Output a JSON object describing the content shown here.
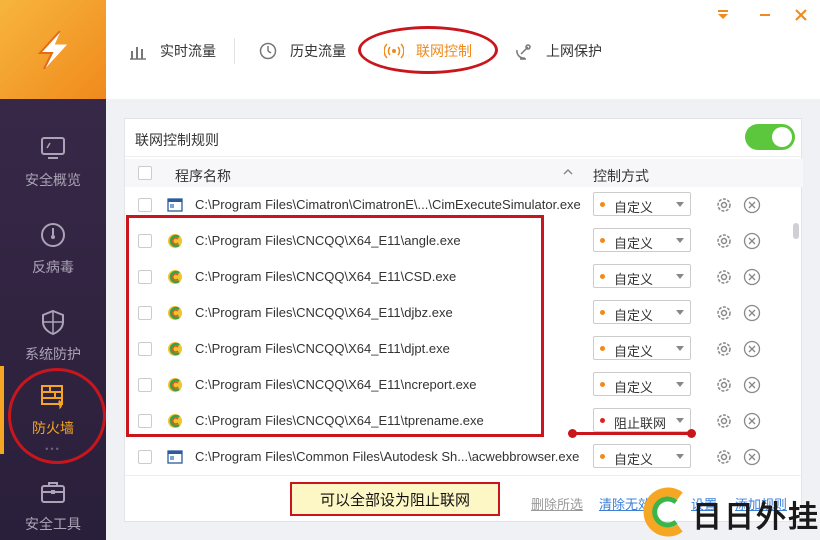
{
  "sidebar": {
    "items": [
      {
        "label": "安全概览",
        "icon": "monitor-icon"
      },
      {
        "label": "反病毒",
        "icon": "gauge-icon"
      },
      {
        "label": "系统防护",
        "icon": "shield-icon"
      },
      {
        "label": "防火墙",
        "icon": "firewall-icon",
        "active": true
      },
      {
        "label": "安全工具",
        "icon": "toolbox-icon"
      }
    ]
  },
  "tabs": [
    {
      "label": "实时流量",
      "icon": "bar-chart-icon"
    },
    {
      "label": "历史流量",
      "icon": "clock-icon"
    },
    {
      "label": "联网控制",
      "icon": "broadcast-icon",
      "active": true
    },
    {
      "label": "上网保护",
      "icon": "satellite-icon"
    }
  ],
  "panel": {
    "title": "联网控制规则",
    "toggle_on": true
  },
  "table": {
    "col_program": "程序名称",
    "col_control": "控制方式",
    "rows": [
      {
        "path": "C:\\Program Files\\Cimatron\\CimatronE\\...\\CimExecuteSimulator.exe",
        "mode": "自定义",
        "mode_color": "orange",
        "icon": "window-app-icon"
      },
      {
        "path": "C:\\Program Files\\CNCQQ\\X64_E11\\angle.exe",
        "mode": "自定义",
        "mode_color": "orange",
        "icon": "cimatron-app-icon"
      },
      {
        "path": "C:\\Program Files\\CNCQQ\\X64_E11\\CSD.exe",
        "mode": "自定义",
        "mode_color": "orange",
        "icon": "cimatron-app-icon"
      },
      {
        "path": "C:\\Program Files\\CNCQQ\\X64_E11\\djbz.exe",
        "mode": "自定义",
        "mode_color": "orange",
        "icon": "cimatron-app-icon"
      },
      {
        "path": "C:\\Program Files\\CNCQQ\\X64_E11\\djpt.exe",
        "mode": "自定义",
        "mode_color": "orange",
        "icon": "cimatron-app-icon"
      },
      {
        "path": "C:\\Program Files\\CNCQQ\\X64_E11\\ncreport.exe",
        "mode": "自定义",
        "mode_color": "orange",
        "icon": "cimatron-app-icon"
      },
      {
        "path": "C:\\Program Files\\CNCQQ\\X64_E11\\tprename.exe",
        "mode": "阻止联网",
        "mode_color": "red",
        "icon": "cimatron-app-icon"
      },
      {
        "path": "C:\\Program Files\\Common Files\\Autodesk Sh...\\acwebbrowser.exe",
        "mode": "自定义",
        "mode_color": "orange",
        "icon": "window-app-icon"
      }
    ]
  },
  "footer": {
    "delete_selected": "删除所选",
    "clear_invalid": "清除无效",
    "settings": "设置",
    "add_rule": "添加规则"
  },
  "annotation": {
    "note": "可以全部设为阻止联网"
  },
  "watermark": {
    "text": "日日外挂"
  },
  "colors": {
    "accent": "#f08a1d",
    "sidebar_bg": "#2a1f3a",
    "toggle_on": "#5cc73c",
    "annotation_red": "#c9161d"
  }
}
